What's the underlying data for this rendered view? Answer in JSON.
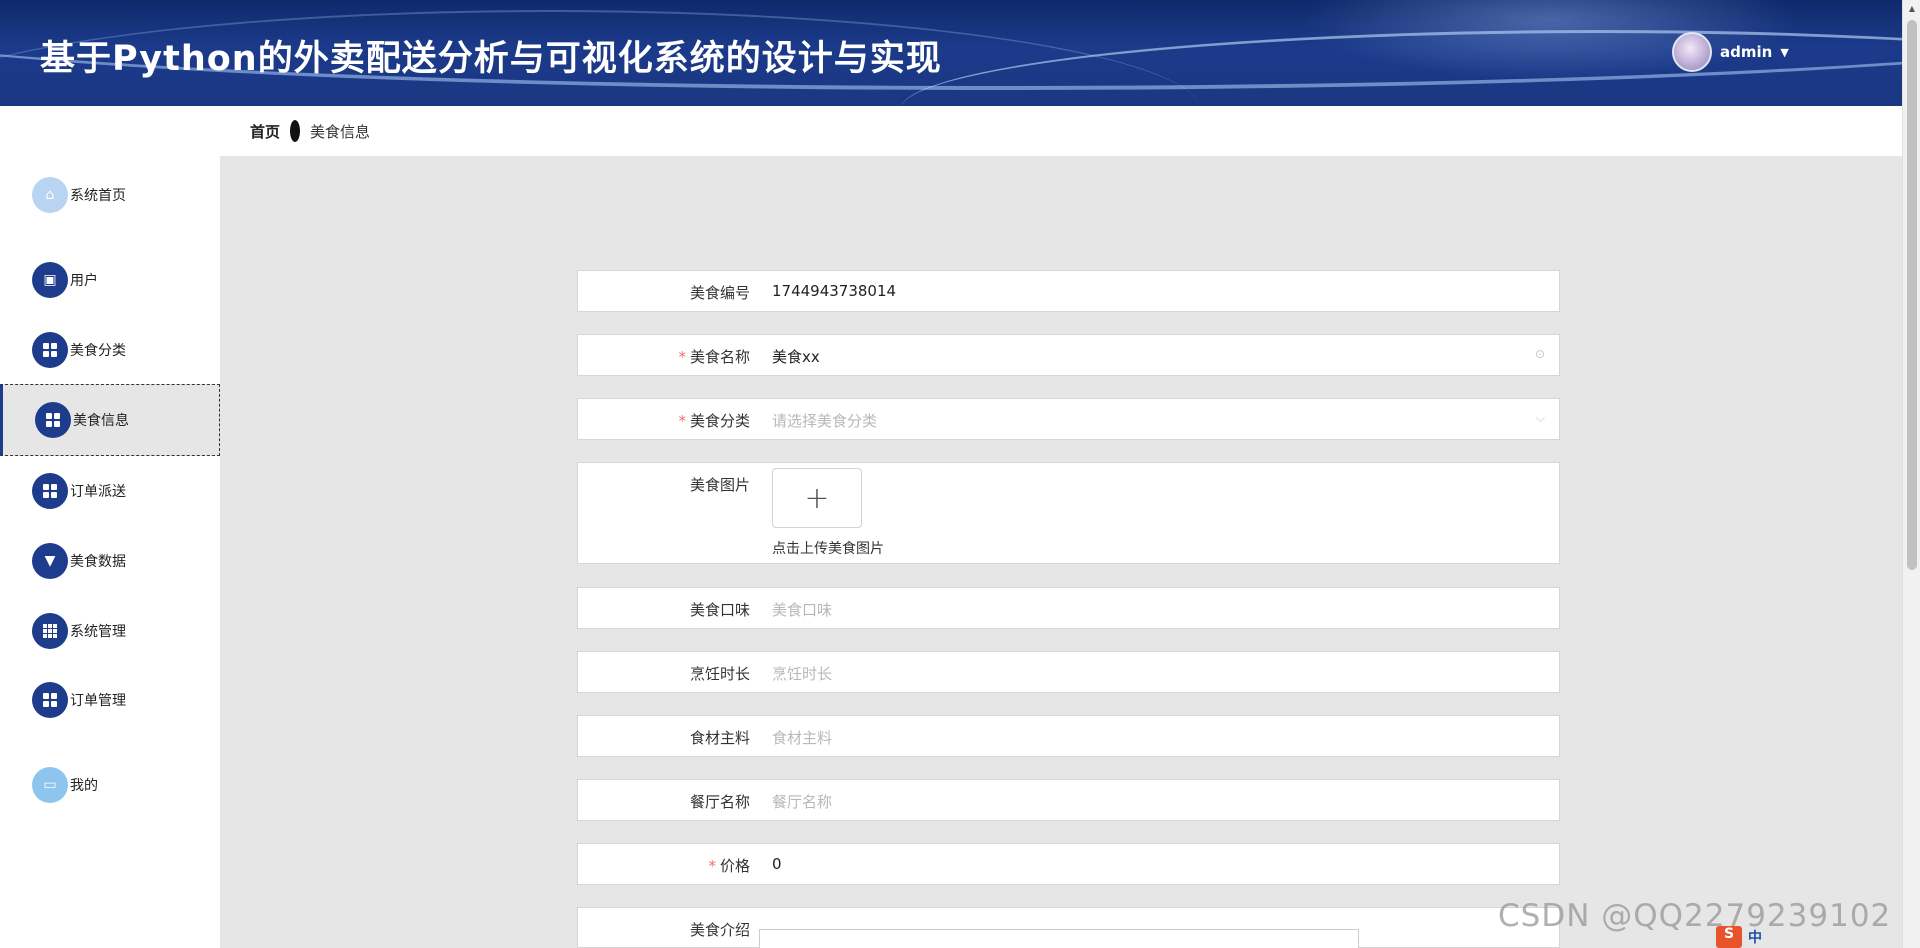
{
  "header": {
    "title": "基于Python的外卖配送分析与可视化系统的设计与实现",
    "username": "admin"
  },
  "breadcrumb": {
    "home": "首页",
    "current": "美食信息"
  },
  "sidebar": {
    "items": [
      {
        "label": "系统首页",
        "icon": "home-icon"
      },
      {
        "label": "用户",
        "icon": "user-icon"
      },
      {
        "label": "美食分类",
        "icon": "grid-icon"
      },
      {
        "label": "美食信息",
        "icon": "grid-icon",
        "active": true
      },
      {
        "label": "订单派送",
        "icon": "grid-icon"
      },
      {
        "label": "美食数据",
        "icon": "data-icon"
      },
      {
        "label": "系统管理",
        "icon": "table-icon"
      },
      {
        "label": "订单管理",
        "icon": "grid-icon"
      },
      {
        "label": "我的",
        "icon": "profile-icon"
      }
    ]
  },
  "form": {
    "food_id": {
      "label": "美食编号",
      "value": "1744943738014"
    },
    "food_name": {
      "label": "美食名称",
      "value": "美食xx"
    },
    "food_category": {
      "label": "美食分类",
      "placeholder": "请选择美食分类"
    },
    "food_image": {
      "label": "美食图片",
      "tip": "点击上传美食图片"
    },
    "flavor": {
      "label": "美食口味",
      "placeholder": "美食口味"
    },
    "cook_time": {
      "label": "烹饪时长",
      "placeholder": "烹饪时长"
    },
    "ingredients": {
      "label": "食材主料",
      "placeholder": "食材主料"
    },
    "restaurant": {
      "label": "餐厅名称",
      "placeholder": "餐厅名称"
    },
    "price": {
      "label": "价格",
      "value": "0"
    },
    "intro": {
      "label": "美食介绍"
    }
  },
  "watermark": "CSDN @QQ2279239102",
  "ime": {
    "label": "中"
  },
  "colors": {
    "header": "#1b3a8a",
    "accent": "#1e3c8c",
    "required": "#f56c6c"
  }
}
